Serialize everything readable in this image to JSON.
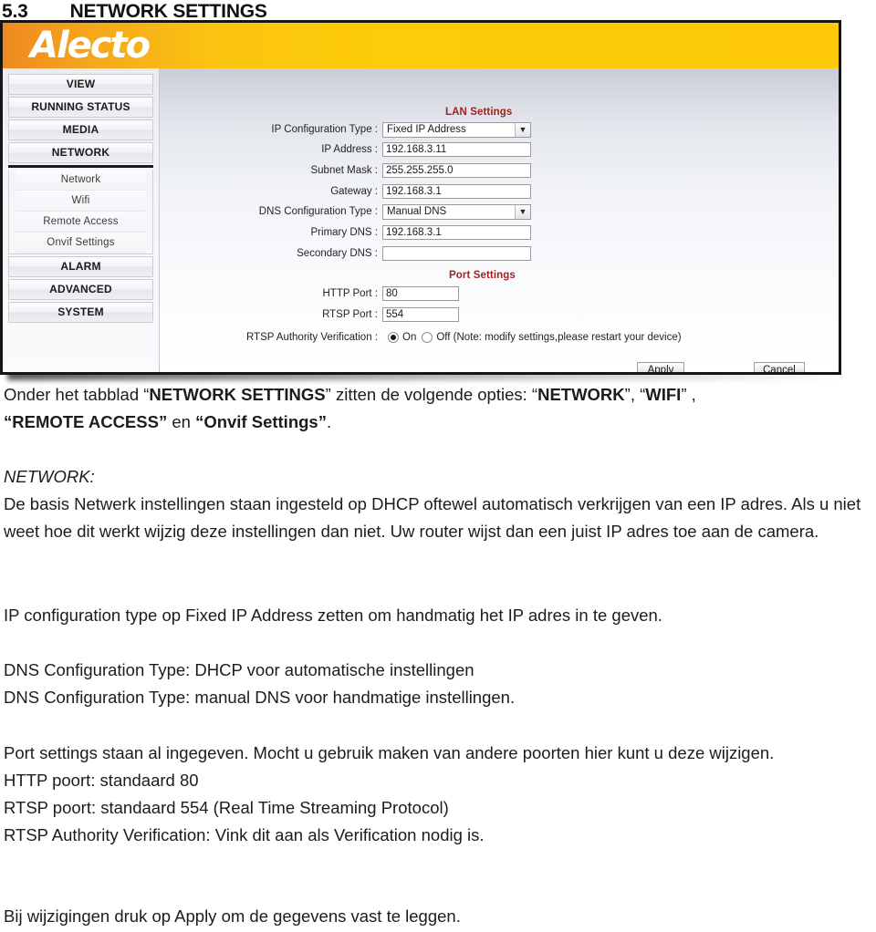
{
  "document": {
    "section_number": "5.3",
    "section_title": "NETWORK SETTINGS"
  },
  "screenshot": {
    "brand": "Alecto",
    "brand_colors": {
      "orange": "#ee8a20",
      "yellow": "#fdc908"
    },
    "sidebar": {
      "items": [
        {
          "label": "VIEW",
          "type": "main"
        },
        {
          "label": "RUNNING STATUS",
          "type": "main"
        },
        {
          "label": "MEDIA",
          "type": "main"
        },
        {
          "label": "NETWORK",
          "type": "main",
          "selected": true
        }
      ],
      "subitems": [
        {
          "label": "Network"
        },
        {
          "label": "Wifi"
        },
        {
          "label": "Remote Access"
        },
        {
          "label": "Onvif Settings"
        }
      ],
      "items_after": [
        {
          "label": "ALARM",
          "type": "main"
        },
        {
          "label": "ADVANCED",
          "type": "main"
        },
        {
          "label": "SYSTEM",
          "type": "main"
        }
      ]
    },
    "lan": {
      "section_label": "LAN Settings",
      "section_color": "#9f2220",
      "ip_config_type_label": "IP Configuration Type :",
      "ip_config_type_value": "Fixed IP Address",
      "ip_address_label": "IP Address :",
      "ip_address_value": "192.168.3.11",
      "subnet_mask_label": "Subnet Mask :",
      "subnet_mask_value": "255.255.255.0",
      "gateway_label": "Gateway :",
      "gateway_value": "192.168.3.1",
      "dns_config_type_label": "DNS Configuration Type :",
      "dns_config_type_value": "Manual DNS",
      "primary_dns_label": "Primary DNS :",
      "primary_dns_value": "192.168.3.1",
      "secondary_dns_label": "Secondary DNS :",
      "secondary_dns_value": ""
    },
    "port": {
      "section_label": "Port Settings",
      "http_port_label": "HTTP Port :",
      "http_port_value": "80",
      "rtsp_port_label": "RTSP Port :",
      "rtsp_port_value": "554",
      "rtsp_auth_label": "RTSP Authority Verification :",
      "rtsp_auth_on": "On",
      "rtsp_auth_off": "Off (Note: modify settings,please restart your device)",
      "rtsp_auth_selected": "On"
    },
    "buttons": {
      "apply": "Apply",
      "cancel": "Cancel"
    }
  },
  "body": {
    "intro": {
      "p1": "Onder het tabblad “",
      "b1": "NETWORK SETTINGS",
      "p2": "” zitten de volgende opties: “",
      "b2": "NETWORK",
      "p3": "”, “",
      "b3": "WIFI",
      "p4": "” ,",
      "b4": "“REMOTE ACCESS”",
      "p5": " en ",
      "b5": "“Onvif Settings”",
      "p6": "."
    },
    "network_heading": "NETWORK:",
    "network_body": "De basis Netwerk instellingen staan ingesteld op DHCP oftewel automatisch verkrijgen van een IP adres. Als u niet weet hoe dit werkt wijzig deze instellingen dan niet. Uw router wijst dan een juist IP adres toe aan de camera.",
    "ip_config_line": "IP configuration type op Fixed IP Address zetten om handmatig het IP adres in te geven.",
    "dns_line_1": "DNS Configuration Type: DHCP voor automatische instellingen",
    "dns_line_2": "DNS Configuration Type: manual DNS voor handmatige instellingen.",
    "port_para": "Port settings staan al ingegeven. Mocht u gebruik maken van andere poorten hier kunt u deze wijzigen.",
    "http_line": "HTTP poort: standaard 80",
    "rtsp_line": "RTSP poort: standaard 554 (Real Time Streaming Protocol)",
    "rtsp_auth_line": "RTSP Authority Verification: Vink dit aan als Verification nodig is.",
    "apply_line": "Bij wijzigingen druk op Apply om de gegevens vast te leggen."
  }
}
